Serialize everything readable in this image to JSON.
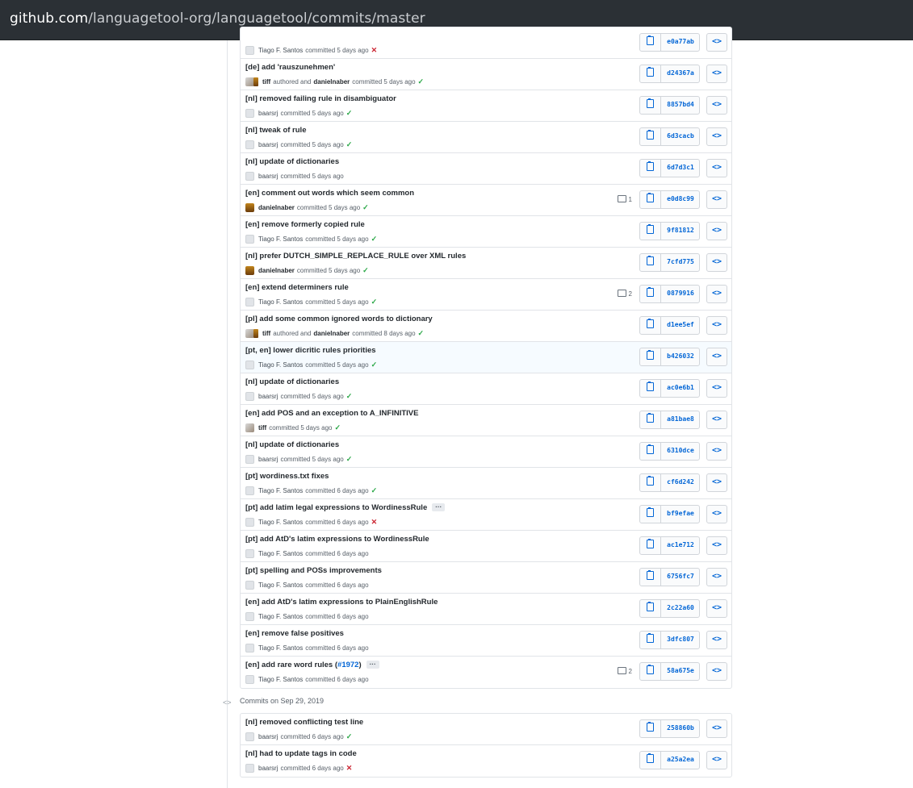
{
  "browser": {
    "url_host": "github.com",
    "url_path": "/languagetool-org/languagetool/commits/master"
  },
  "commit_groups": [
    {
      "commits": [
        {
          "title": "",
          "authors": [
            {
              "name": "Tiago F. Santos",
              "avatar": "gray",
              "strong": false
            }
          ],
          "verb": "committed 5 days ago",
          "status": "fail",
          "sha": "e0a77ab",
          "comments": ""
        },
        {
          "title": "[de] add 'rauszunehmen'",
          "authors": [
            {
              "name": "tiff",
              "avatar": "tiff",
              "strong": true
            },
            {
              "name": "danielnaber",
              "avatar": "none",
              "strong": true
            }
          ],
          "authored_text": "authored and",
          "verb": "committed 5 days ago",
          "status": "ok",
          "sha": "d24367a",
          "comments": ""
        },
        {
          "title": "[nl] removed failing rule in disambiguator",
          "authors": [
            {
              "name": "baarsrj",
              "avatar": "gray",
              "strong": false
            }
          ],
          "verb": "committed 5 days ago",
          "status": "ok",
          "sha": "8857bd4",
          "comments": ""
        },
        {
          "title": "[nl] tweak of rule",
          "authors": [
            {
              "name": "baarsrj",
              "avatar": "gray",
              "strong": false
            }
          ],
          "verb": "committed 5 days ago",
          "status": "ok",
          "sha": "6d3cacb",
          "comments": ""
        },
        {
          "title": "[nl] update of dictionaries",
          "authors": [
            {
              "name": "baarsrj",
              "avatar": "gray",
              "strong": false
            }
          ],
          "verb": "committed 5 days ago",
          "status": "none",
          "sha": "6d7d3c1",
          "comments": ""
        },
        {
          "title": "[en] comment out words which seem common",
          "authors": [
            {
              "name": "danielnaber",
              "avatar": "dn",
              "strong": true
            }
          ],
          "verb": "committed 5 days ago",
          "status": "ok",
          "sha": "e0d8c99",
          "comments": "1"
        },
        {
          "title": "[en] remove formerly copied rule",
          "authors": [
            {
              "name": "Tiago F. Santos",
              "avatar": "gray",
              "strong": false
            }
          ],
          "verb": "committed 5 days ago",
          "status": "ok",
          "sha": "9f81812",
          "comments": ""
        },
        {
          "title": "[nl] prefer DUTCH_SIMPLE_REPLACE_RULE over XML rules",
          "authors": [
            {
              "name": "danielnaber",
              "avatar": "dn",
              "strong": true
            }
          ],
          "verb": "committed 5 days ago",
          "status": "ok",
          "sha": "7cfd775",
          "comments": ""
        },
        {
          "title": "[en] extend determiners rule",
          "authors": [
            {
              "name": "Tiago F. Santos",
              "avatar": "gray",
              "strong": false
            }
          ],
          "verb": "committed 5 days ago",
          "status": "ok",
          "sha": "0879916",
          "comments": "2"
        },
        {
          "title": "[pl] add some common ignored words to dictionary",
          "authors": [
            {
              "name": "tiff",
              "avatar": "tiff",
              "strong": true
            },
            {
              "name": "danielnaber",
              "avatar": "none",
              "strong": true
            }
          ],
          "authored_text": "authored and",
          "verb": "committed 8 days ago",
          "status": "ok",
          "sha": "d1ee5ef",
          "comments": ""
        },
        {
          "title": "[pt, en] lower dicritic rules priorities",
          "authors": [
            {
              "name": "Tiago F. Santos",
              "avatar": "gray",
              "strong": false
            }
          ],
          "verb": "committed 5 days ago",
          "status": "ok",
          "sha": "b426032",
          "comments": "",
          "highlight": true
        },
        {
          "title": "[nl] update of dictionaries",
          "authors": [
            {
              "name": "baarsrj",
              "avatar": "gray",
              "strong": false
            }
          ],
          "verb": "committed 5 days ago",
          "status": "ok",
          "sha": "ac0e6b1",
          "comments": ""
        },
        {
          "title": "[en] add POS and an exception to A_INFINITIVE",
          "authors": [
            {
              "name": "tiff",
              "avatar": "tiff",
              "strong": true
            }
          ],
          "verb": "committed 5 days ago",
          "status": "ok",
          "sha": "a81bae8",
          "comments": ""
        },
        {
          "title": "[nl] update of dictionaries",
          "authors": [
            {
              "name": "baarsrj",
              "avatar": "gray",
              "strong": false
            }
          ],
          "verb": "committed 5 days ago",
          "status": "ok",
          "sha": "6310dce",
          "comments": ""
        },
        {
          "title": "[pt] wordiness.txt fixes",
          "authors": [
            {
              "name": "Tiago F. Santos",
              "avatar": "gray",
              "strong": false
            }
          ],
          "verb": "committed 6 days ago",
          "status": "ok",
          "sha": "cf6d242",
          "comments": ""
        },
        {
          "title": "[pt] add latim legal expressions to WordinessRule",
          "ellipsis": "···",
          "authors": [
            {
              "name": "Tiago F. Santos",
              "avatar": "gray",
              "strong": false
            }
          ],
          "verb": "committed 6 days ago",
          "status": "fail",
          "sha": "bf9efae",
          "comments": ""
        },
        {
          "title": "[pt] add AtD's latim expressions to WordinessRule",
          "authors": [
            {
              "name": "Tiago F. Santos",
              "avatar": "gray",
              "strong": false
            }
          ],
          "verb": "committed 6 days ago",
          "status": "none",
          "sha": "ac1e712",
          "comments": ""
        },
        {
          "title": "[pt] spelling and POSs improvements",
          "authors": [
            {
              "name": "Tiago F. Santos",
              "avatar": "gray",
              "strong": false
            }
          ],
          "verb": "committed 6 days ago",
          "status": "none",
          "sha": "6756fc7",
          "comments": ""
        },
        {
          "title": "[en] add AtD's latim expressions to PlainEnglishRule",
          "authors": [
            {
              "name": "Tiago F. Santos",
              "avatar": "gray",
              "strong": false
            }
          ],
          "verb": "committed 6 days ago",
          "status": "none",
          "sha": "2c22a60",
          "comments": ""
        },
        {
          "title": "[en] remove false positives",
          "authors": [
            {
              "name": "Tiago F. Santos",
              "avatar": "gray",
              "strong": false
            }
          ],
          "verb": "committed 6 days ago",
          "status": "none",
          "sha": "3dfc807",
          "comments": ""
        },
        {
          "title": "[en] add rare word rules (",
          "link": "#1972",
          "title_after": ")",
          "ellipsis": "···",
          "authors": [
            {
              "name": "Tiago F. Santos",
              "avatar": "gray",
              "strong": false
            }
          ],
          "verb": "committed 6 days ago",
          "status": "none",
          "sha": "58a675e",
          "comments": "2"
        }
      ]
    },
    {
      "header": "Commits on Sep 29, 2019",
      "commits": [
        {
          "title": "[nl] removed conflicting test line",
          "authors": [
            {
              "name": "baarsrj",
              "avatar": "gray",
              "strong": false
            }
          ],
          "verb": "committed 6 days ago",
          "status": "ok",
          "sha": "258860b",
          "comments": ""
        },
        {
          "title": "[nl] had to update tags in code",
          "authors": [
            {
              "name": "baarsrj",
              "avatar": "gray",
              "strong": false
            }
          ],
          "verb": "committed 6 days ago",
          "status": "fail",
          "sha": "a25a2ea",
          "comments": ""
        }
      ]
    }
  ],
  "icons": {
    "ok": "check-icon",
    "fail": "x-icon",
    "copy": "clipboard-icon",
    "browse": "code-icon",
    "comment": "comment-icon"
  },
  "colors": {
    "link": "#0366d6",
    "ok": "#28a745",
    "fail": "#cb2431",
    "urlbar": "#2b3035"
  }
}
